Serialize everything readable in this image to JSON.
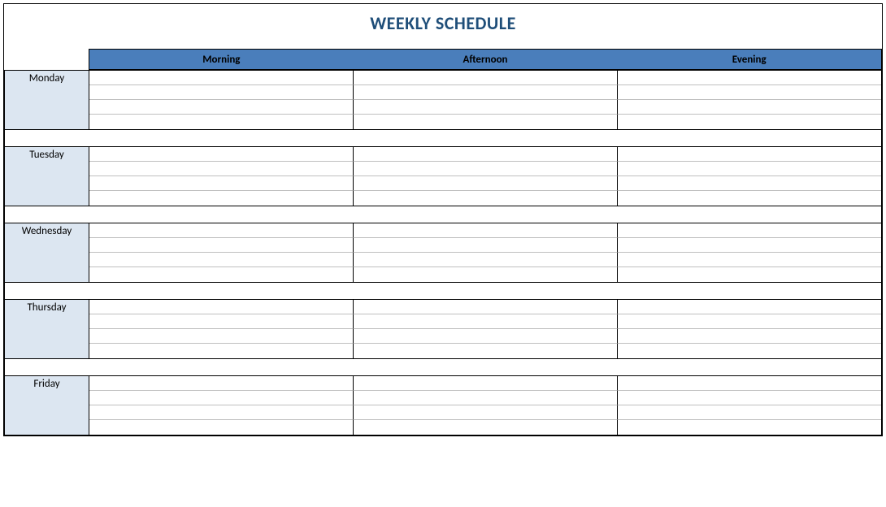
{
  "title": "WEEKLY SCHEDULE",
  "columns": [
    "Morning",
    "Afternoon",
    "Evening"
  ],
  "days": [
    {
      "label": "Monday"
    },
    {
      "label": "Tuesday"
    },
    {
      "label": "Wednesday"
    },
    {
      "label": "Thursday"
    },
    {
      "label": "Friday"
    }
  ],
  "rows_per_day": 4
}
